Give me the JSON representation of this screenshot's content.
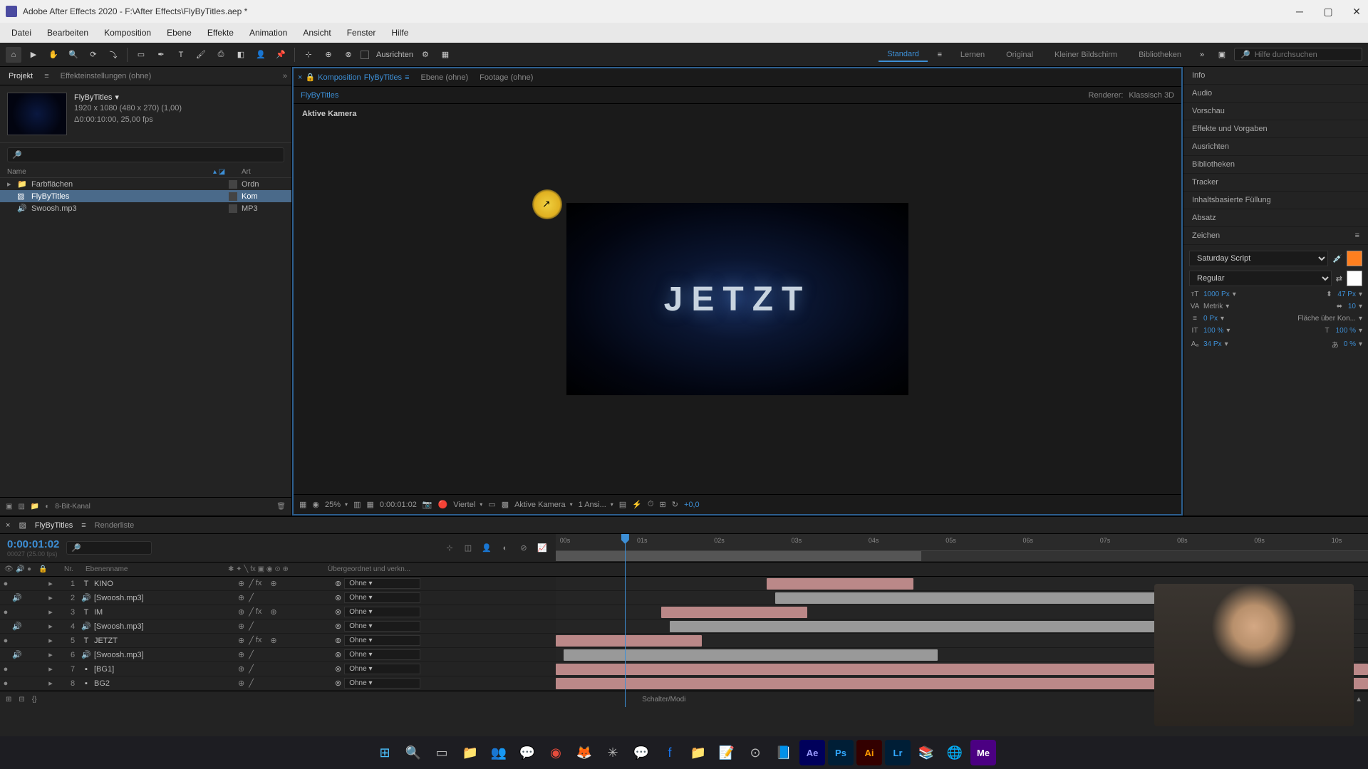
{
  "titlebar": {
    "title": "Adobe After Effects 2020 - F:\\After Effects\\FlyByTitles.aep *"
  },
  "menu": {
    "items": [
      "Datei",
      "Bearbeiten",
      "Komposition",
      "Ebene",
      "Effekte",
      "Animation",
      "Ansicht",
      "Fenster",
      "Hilfe"
    ]
  },
  "toolbar": {
    "ausrichten": "Ausrichten",
    "workspaces": [
      "Standard",
      "Lernen",
      "Original",
      "Kleiner Bildschirm",
      "Bibliotheken"
    ],
    "search_placeholder": "Hilfe durchsuchen"
  },
  "project": {
    "tab_project": "Projekt",
    "tab_effects": "Effekteinstellungen (ohne)",
    "comp_name": "FlyByTitles",
    "comp_dims": "1920 x 1080 (480 x 270) (1,00)",
    "comp_dur": "Δ0:00:10:00, 25,00 fps",
    "col_name": "Name",
    "col_type": "Art",
    "items": [
      {
        "name": "Farbflächen",
        "type": "Ordn",
        "icon": "folder"
      },
      {
        "name": "FlyByTitles",
        "type": "Kom",
        "icon": "comp",
        "selected": true
      },
      {
        "name": "Swoosh.mp3",
        "type": "MP3",
        "icon": "audio"
      }
    ],
    "footer_bpc": "8-Bit-Kanal"
  },
  "composition": {
    "tab_label": "Komposition",
    "tab_name": "FlyByTitles",
    "tab_ebene": "Ebene (ohne)",
    "tab_footage": "Footage (ohne)",
    "renderer_label": "Renderer:",
    "renderer_value": "Klassisch 3D",
    "breadcrumb": "FlyByTitles",
    "viewer_label": "Aktive Kamera",
    "canvas_text": "JETZT",
    "footer": {
      "zoom": "25%",
      "timecode": "0:00:01:02",
      "quality": "Viertel",
      "camera": "Aktive Kamera",
      "views": "1 Ansi...",
      "exposure": "+0,0"
    }
  },
  "right": {
    "items": [
      "Info",
      "Audio",
      "Vorschau",
      "Effekte und Vorgaben",
      "Ausrichten",
      "Bibliotheken",
      "Tracker",
      "Inhaltsbasierte Füllung",
      "Absatz"
    ],
    "zeichen": "Zeichen",
    "font": "Saturday Script",
    "style": "Regular",
    "size": "1000 Px",
    "leading": "47 Px",
    "kerning": "Metrik",
    "tracking": "10",
    "stroke": "0 Px",
    "stroke_label": "Fläche über Kon...",
    "vscale": "100 %",
    "hscale": "100 %",
    "baseline": "34 Px",
    "tsume": "0 %"
  },
  "timeline": {
    "tab_comp": "FlyByTitles",
    "tab_render": "Renderliste",
    "timecode": "0:00:01:02",
    "timecode_sub": "00027 (25.00 fps)",
    "ruler": [
      "00s",
      "01s",
      "02s",
      "03s",
      "04s",
      "05s",
      "06s",
      "07s",
      "08s",
      "09s",
      "10s"
    ],
    "col_header_right": "Übergeordnet und verkn...",
    "col_nr": "Nr.",
    "col_name": "Ebenenname",
    "parent_none": "Ohne",
    "footer_label": "Schalter/Modi",
    "layers": [
      {
        "n": 1,
        "name": "KINO",
        "type": "T",
        "color": "#c94444",
        "eye": true,
        "spk": false,
        "d3": true,
        "bar_start": 26,
        "bar_end": 44,
        "bg": "#b88"
      },
      {
        "n": 2,
        "name": "[Swoosh.mp3]",
        "type": "A",
        "color": "#c94444",
        "eye": false,
        "spk": true,
        "d3": false,
        "bar_start": 27,
        "bar_end": 74,
        "bg": "#999"
      },
      {
        "n": 3,
        "name": "IM",
        "type": "T",
        "color": "#c94444",
        "eye": true,
        "spk": false,
        "d3": true,
        "bar_start": 13,
        "bar_end": 31,
        "bg": "#b88"
      },
      {
        "n": 4,
        "name": "[Swoosh.mp3]",
        "type": "A",
        "color": "#c94444",
        "eye": false,
        "spk": true,
        "d3": false,
        "bar_start": 14,
        "bar_end": 74,
        "bg": "#999"
      },
      {
        "n": 5,
        "name": "JETZT",
        "type": "T",
        "color": "#c94444",
        "eye": true,
        "spk": false,
        "d3": true,
        "bar_start": 0,
        "bar_end": 18,
        "bg": "#b88"
      },
      {
        "n": 6,
        "name": "[Swoosh.mp3]",
        "type": "A",
        "color": "#c94444",
        "eye": false,
        "spk": true,
        "d3": false,
        "bar_start": 1,
        "bar_end": 47,
        "bg": "#999"
      },
      {
        "n": 7,
        "name": "[BG1]",
        "type": "S",
        "color": "#c94444",
        "eye": true,
        "spk": false,
        "d3": false,
        "bar_start": 0,
        "bar_end": 100,
        "bg": "#b88"
      },
      {
        "n": 8,
        "name": "BG2",
        "type": "S",
        "color": "#c94444",
        "eye": true,
        "spk": false,
        "d3": false,
        "bar_start": 0,
        "bar_end": 100,
        "bg": "#b88"
      }
    ]
  }
}
